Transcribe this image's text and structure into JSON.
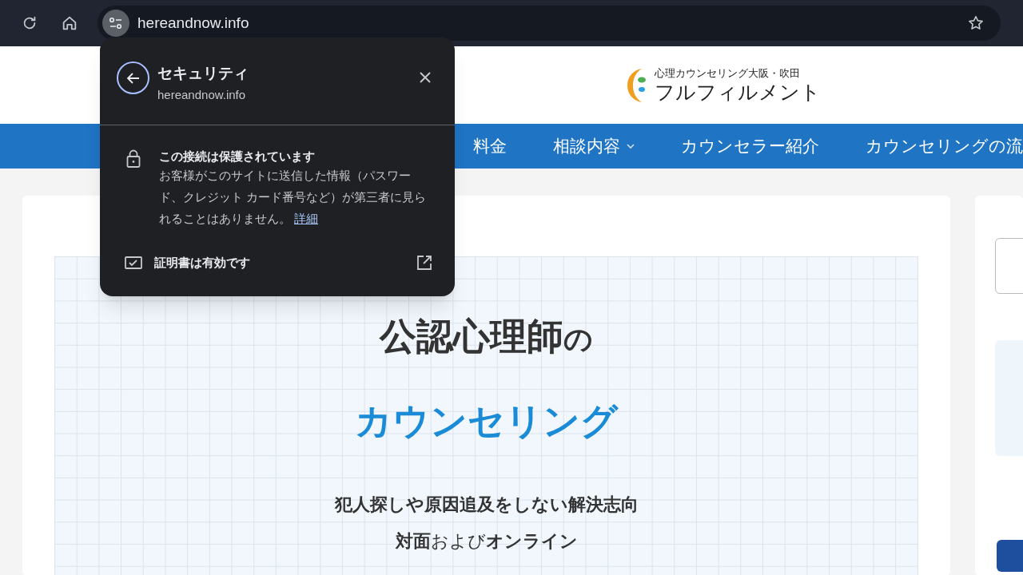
{
  "browser": {
    "url": "hereandnow.info"
  },
  "popup": {
    "title": "セキュリティ",
    "subtitle": "hereandnow.info",
    "heading": "この接続は保護されています",
    "body": "お客様がこのサイトに送信した情報（パスワード、クレジット カード番号など）が第三者に見られることはありません。",
    "link": "詳細",
    "certificate": "証明書は有効です"
  },
  "site": {
    "logo_tagline": "心理カウンセリング大阪・吹田",
    "logo_name": "フルフィルメント",
    "nav": [
      {
        "label": "料金",
        "has_dropdown": false
      },
      {
        "label": "相談内容",
        "has_dropdown": true
      },
      {
        "label": "カウンセラー紹介",
        "has_dropdown": false
      },
      {
        "label": "カウンセリングの流",
        "has_dropdown": false
      }
    ],
    "hero": {
      "title_main": "公認心理師",
      "title_suffix": "の",
      "subtitle": "カウンセリング",
      "lines": [
        "犯人探しや原因追及をしない解決志向",
        "**対面**および**オンライン**"
      ]
    }
  }
}
